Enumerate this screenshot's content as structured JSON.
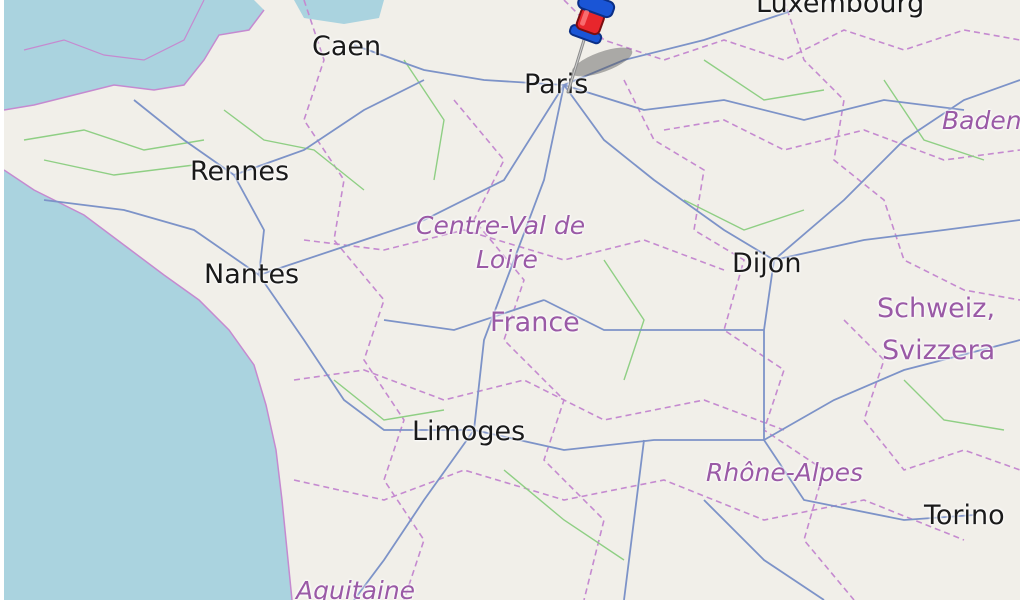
{
  "map": {
    "colors": {
      "land": "#f1efe9",
      "water": "#aad3df",
      "roads": "#7d93c8",
      "minor_roads": "#8fcf84",
      "borders": "#c58ad0",
      "labels_city": "#1a1a1a",
      "labels_region": "#9a5aa6"
    },
    "cities": {
      "luxembourg": "Luxembourg",
      "caen": "Caen",
      "paris": "Paris",
      "rennes": "Rennes",
      "nantes": "Nantes",
      "dijon": "Dijon",
      "limoges": "Limoges",
      "torino": "Torino"
    },
    "regions": {
      "baden": "Baden",
      "centre_line1": "Centre-Val de",
      "centre_line2": "Loire",
      "rhone_alpes": "Rhône-Alpes",
      "aquitaine": "Aquitaine"
    },
    "countries": {
      "france": "France",
      "schweiz_line1": "Schweiz,",
      "schweiz_line2": "Svizzera"
    },
    "marker": {
      "icon": "pushpin-icon",
      "color": "#e8262c",
      "location": "Paris"
    }
  }
}
